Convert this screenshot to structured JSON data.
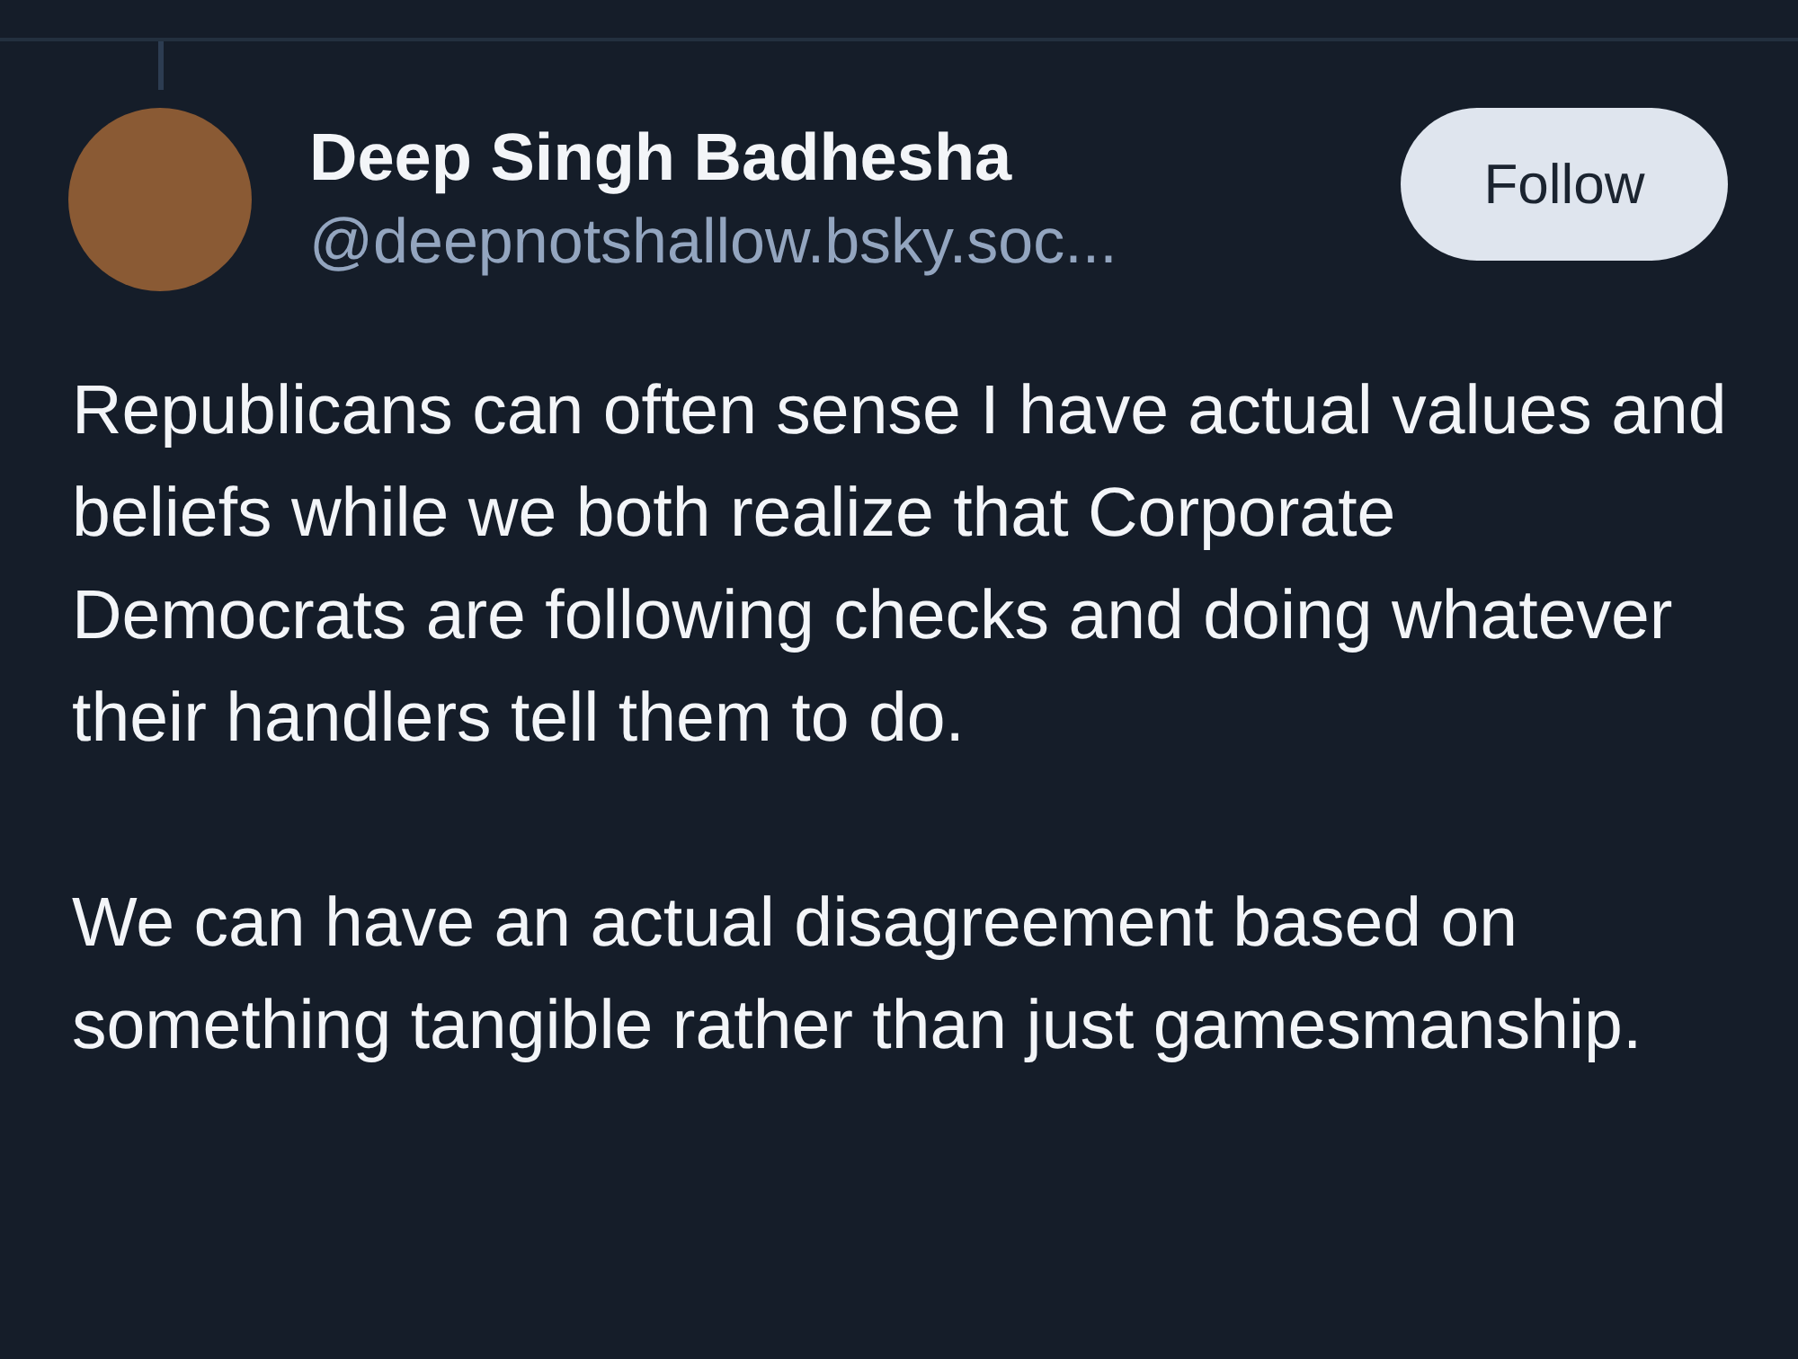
{
  "post": {
    "author": {
      "name": "Deep Singh Badhesha",
      "handle": "@deepnotshallow.bsky.soc..."
    },
    "follow_button": {
      "label": "Follow"
    },
    "paragraphs": [
      "Republicans can often sense I have actual values and beliefs while we both realize that Corporate Democrats are following checks and doing whatever their handlers tell them to do.",
      "We can have an actual disagreement based on something tangible rather than just gamesmanship."
    ]
  }
}
